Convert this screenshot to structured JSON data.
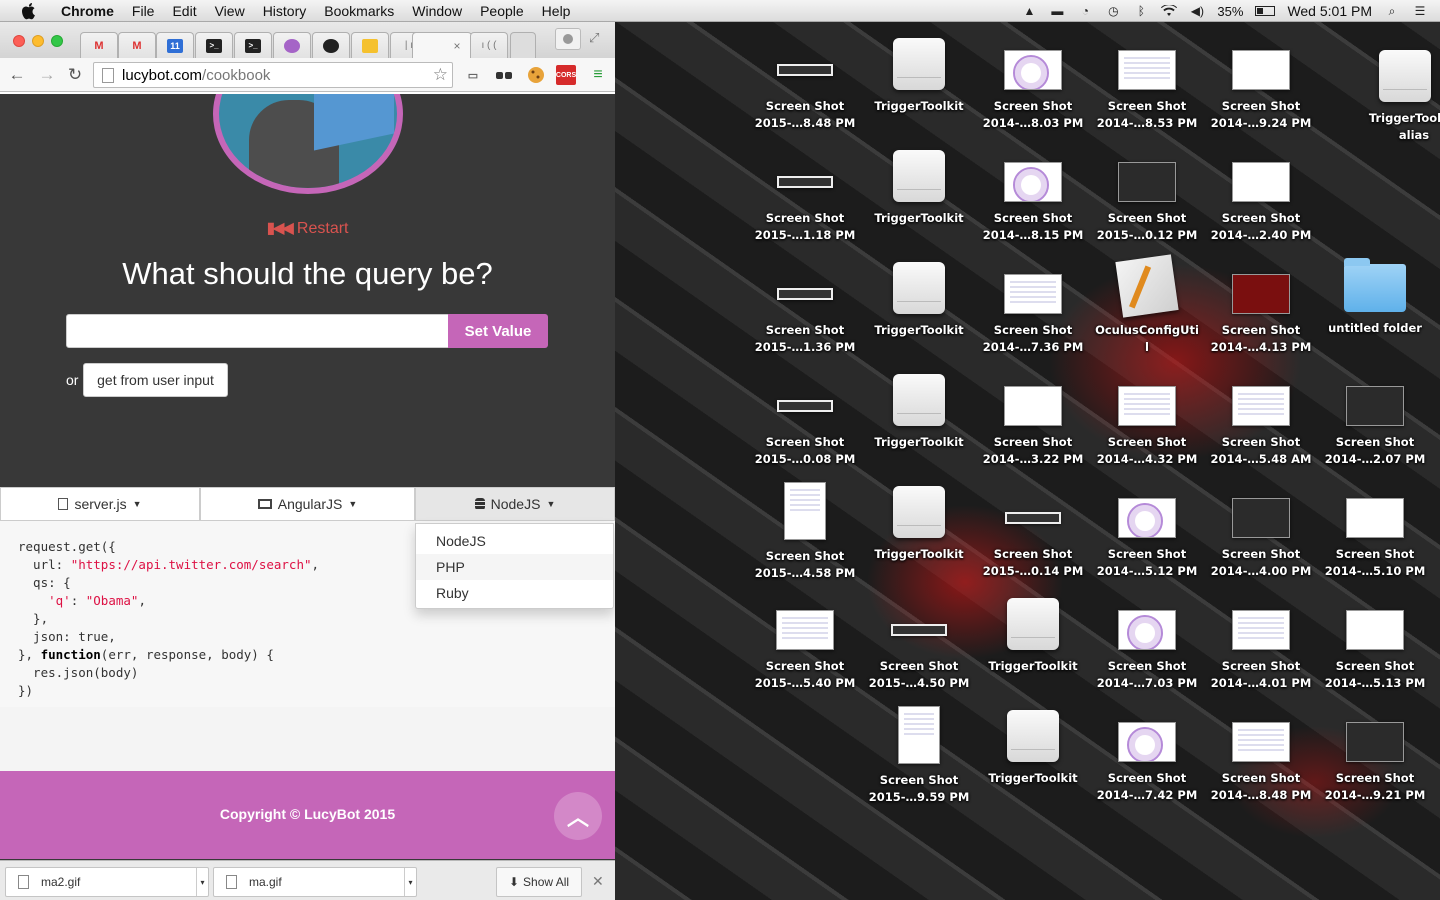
{
  "menubar": {
    "app": "Chrome",
    "menus": [
      "File",
      "Edit",
      "View",
      "History",
      "Bookmarks",
      "Window",
      "People",
      "Help"
    ],
    "battery": "35%",
    "clock": "Wed 5:01 PM"
  },
  "browser": {
    "url_host": "lucybot.com",
    "url_path": "/cookbook",
    "ext_cors": "CORS"
  },
  "page": {
    "restart": "Restart",
    "question": "What should the query be?",
    "input_value": "",
    "set_value": "Set Value",
    "or": "or",
    "user_input_btn": "get from user input",
    "tabs": [
      "server.js",
      "AngularJS",
      "NodeJS"
    ],
    "dropdown": [
      "NodeJS",
      "PHP",
      "Ruby"
    ],
    "code": {
      "l1": "request.get({",
      "l2a": "  url: ",
      "l2s": "\"https://api.twitter.com/search\"",
      "l2b": ",",
      "l3": "  qs: {",
      "l4s1": "    'q'",
      "l4m": ": ",
      "l4s2": "\"Obama\"",
      "l4b": ",",
      "l5": "  },",
      "l6": "  json: true,",
      "l7a": "}, ",
      "l7k": "function",
      "l7b": "(err, response, body) {",
      "l8": "  res.json(body)",
      "l9": "})"
    },
    "copyright": "Copyright © LucyBot 2015"
  },
  "downloads": {
    "items": [
      "ma2.gif",
      "ma.gif"
    ],
    "show_all": "Show All"
  },
  "desktop": {
    "icons": [
      {
        "l1": "Screen Shot",
        "l2": "2015-…8.48 PM"
      },
      {
        "l1": "TriggerToolkit",
        "l2": ""
      },
      {
        "l1": "Screen Shot",
        "l2": "2014-…8.03 PM"
      },
      {
        "l1": "Screen Shot",
        "l2": "2014-…8.53 PM"
      },
      {
        "l1": "Screen Shot",
        "l2": "2014-…9.24 PM"
      },
      {
        "l1": "TriggerTool",
        "l2": "alias"
      },
      {
        "l1": "Screen Shot",
        "l2": "2015-…1.18 PM"
      },
      {
        "l1": "TriggerToolkit",
        "l2": ""
      },
      {
        "l1": "Screen Shot",
        "l2": "2014-…8.15 PM"
      },
      {
        "l1": "Screen Shot",
        "l2": "2015-…0.12 PM"
      },
      {
        "l1": "Screen Shot",
        "l2": "2014-…2.40 PM"
      },
      {
        "l1": "Screen Shot",
        "l2": "2015-…1.36 PM"
      },
      {
        "l1": "TriggerToolkit",
        "l2": ""
      },
      {
        "l1": "Screen Shot",
        "l2": "2014-…7.36 PM"
      },
      {
        "l1": "OculusConfigUti",
        "l2": "l"
      },
      {
        "l1": "Screen Shot",
        "l2": "2014-…4.13 PM"
      },
      {
        "l1": "untitled folder",
        "l2": ""
      },
      {
        "l1": "Screen Shot",
        "l2": "2015-…0.08 PM"
      },
      {
        "l1": "TriggerToolkit",
        "l2": ""
      },
      {
        "l1": "Screen Shot",
        "l2": "2014-…3.22 PM"
      },
      {
        "l1": "Screen Shot",
        "l2": "2014-…4.32 PM"
      },
      {
        "l1": "Screen Shot",
        "l2": "2014-…5.48 AM"
      },
      {
        "l1": "Screen Shot",
        "l2": "2014-…2.07 PM"
      },
      {
        "l1": "Screen Shot",
        "l2": "2015-…4.58 PM"
      },
      {
        "l1": "TriggerToolkit",
        "l2": ""
      },
      {
        "l1": "Screen Shot",
        "l2": "2015-…0.14 PM"
      },
      {
        "l1": "Screen Shot",
        "l2": "2014-…5.12 PM"
      },
      {
        "l1": "Screen Shot",
        "l2": "2014-…4.00 PM"
      },
      {
        "l1": "Screen Shot",
        "l2": "2014-…5.10 PM"
      },
      {
        "l1": "Screen Shot",
        "l2": "2015-…5.40 PM"
      },
      {
        "l1": "Screen Shot",
        "l2": "2015-…4.50 PM"
      },
      {
        "l1": "TriggerToolkit",
        "l2": ""
      },
      {
        "l1": "Screen Shot",
        "l2": "2014-…7.03 PM"
      },
      {
        "l1": "Screen Shot",
        "l2": "2014-…4.01 PM"
      },
      {
        "l1": "Screen Shot",
        "l2": "2014-…5.13 PM"
      },
      {
        "l1": "Screen Shot",
        "l2": "2015-…9.59 PM"
      },
      {
        "l1": "TriggerToolkit",
        "l2": ""
      },
      {
        "l1": "Screen Shot",
        "l2": "2014-…7.42 PM"
      },
      {
        "l1": "Screen Shot",
        "l2": "2014-…8.48 PM"
      },
      {
        "l1": "Screen Shot",
        "l2": "2014-…9.21 PM"
      }
    ]
  }
}
